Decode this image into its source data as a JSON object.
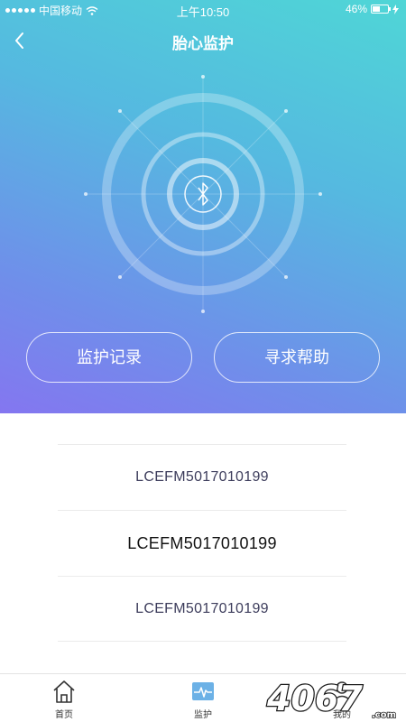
{
  "status_bar": {
    "carrier": "中国移动",
    "time": "上午10:50",
    "battery": "46%"
  },
  "header": {
    "title": "胎心监护"
  },
  "center_icon": "bluetooth-icon",
  "buttons": {
    "records_label": "监护记录",
    "help_label": "寻求帮助"
  },
  "devices": [
    {
      "id": "LCEFM5017010199"
    },
    {
      "id": "LCEFM5017010199"
    },
    {
      "id": "LCEFM5017010199"
    }
  ],
  "tabbar": {
    "items": [
      {
        "label": "首页",
        "icon": "home-icon"
      },
      {
        "label": "监护",
        "icon": "monitor-icon",
        "active": true
      },
      {
        "label": "我的",
        "icon": "user-icon"
      }
    ]
  },
  "watermark": "4067.com",
  "colors": {
    "gradient_top": "#4fd6d6",
    "gradient_bottom": "#8476f0",
    "text_dark": "#3d3d5c"
  }
}
